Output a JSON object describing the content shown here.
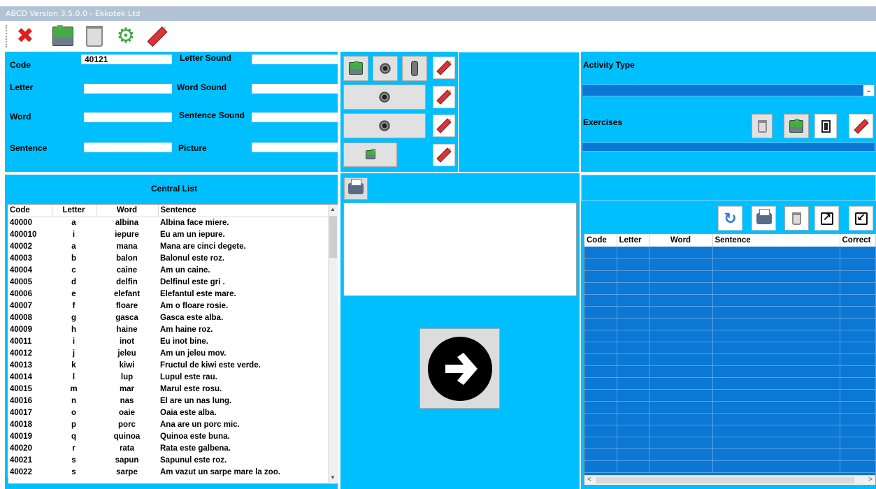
{
  "window": {
    "title": "ABCD Version 3.5.0.0 - Ekkotek Ltd"
  },
  "toolbar": {
    "buttons": [
      "close-icon",
      "save-icon",
      "recycle-bin-icon",
      "refresh-gear-icon",
      "eraser-icon"
    ]
  },
  "form": {
    "code_label": "Code",
    "code_value": "40121",
    "letter_label": "Letter",
    "letter_value": "",
    "word_label": "Word",
    "word_value": "",
    "sentence_label": "Sentence",
    "sentence_value": "",
    "letter_sound_label": "Letter Sound",
    "word_sound_label": "Word Sound",
    "sentence_sound_label": "Sentence Sound",
    "picture_label": "Picture"
  },
  "central_list": {
    "title": "Central List",
    "columns": [
      "Code",
      "Letter",
      "Word",
      "Sentence"
    ],
    "rows": [
      [
        "40000",
        "a",
        "albina",
        "Albina face miere."
      ],
      [
        "400010",
        "i",
        "iepure",
        "Eu am un iepure."
      ],
      [
        "40002",
        "a",
        "mana",
        "Mana are cinci degete."
      ],
      [
        "40003",
        "b",
        "balon",
        "Balonul este roz."
      ],
      [
        "40004",
        "c",
        "caine",
        "Am un caine."
      ],
      [
        "40005",
        "d",
        "delfin",
        "Delfinul este gri ."
      ],
      [
        "40006",
        "e",
        "elefant",
        "Elefantul este mare."
      ],
      [
        "40007",
        "f",
        "floare",
        "Am o floare rosie."
      ],
      [
        "40008",
        "g",
        "gasca",
        "Gasca este alba."
      ],
      [
        "40009",
        "h",
        "haine",
        "Am haine roz."
      ],
      [
        "40011",
        "i",
        "inot",
        "Eu inot bine."
      ],
      [
        "40012",
        "j",
        "jeleu",
        "Am un jeleu mov."
      ],
      [
        "40013",
        "k",
        "kiwi",
        "Fructul de kiwi este verde."
      ],
      [
        "40014",
        "l",
        "lup",
        "Lupul este rau."
      ],
      [
        "40015",
        "m",
        "mar",
        "Marul este rosu."
      ],
      [
        "40016",
        "n",
        "nas",
        "El are un nas lung."
      ],
      [
        "40017",
        "o",
        "oaie",
        "Oaia este alba."
      ],
      [
        "40018",
        "p",
        "porc",
        "Ana are un porc mic."
      ],
      [
        "40019",
        "q",
        "quinoa",
        "Quinoa este buna."
      ],
      [
        "40020",
        "r",
        "rata",
        "Rata este galbena."
      ],
      [
        "40021",
        "s",
        "sapun",
        "Sapunul este roz."
      ],
      [
        "40022",
        "s",
        "sarpe",
        "Am vazut un sarpe mare la zoo."
      ]
    ]
  },
  "right_panel": {
    "activity_type_label": "Activity Type",
    "activity_type_value": "",
    "exercises_label": "Exercises",
    "columns": [
      "Code",
      "Letter",
      "Word",
      "Sentence",
      "Correct"
    ],
    "empty_rows": 19
  },
  "colors": {
    "panel": "#00bfff",
    "selection": "#0a78d4"
  }
}
